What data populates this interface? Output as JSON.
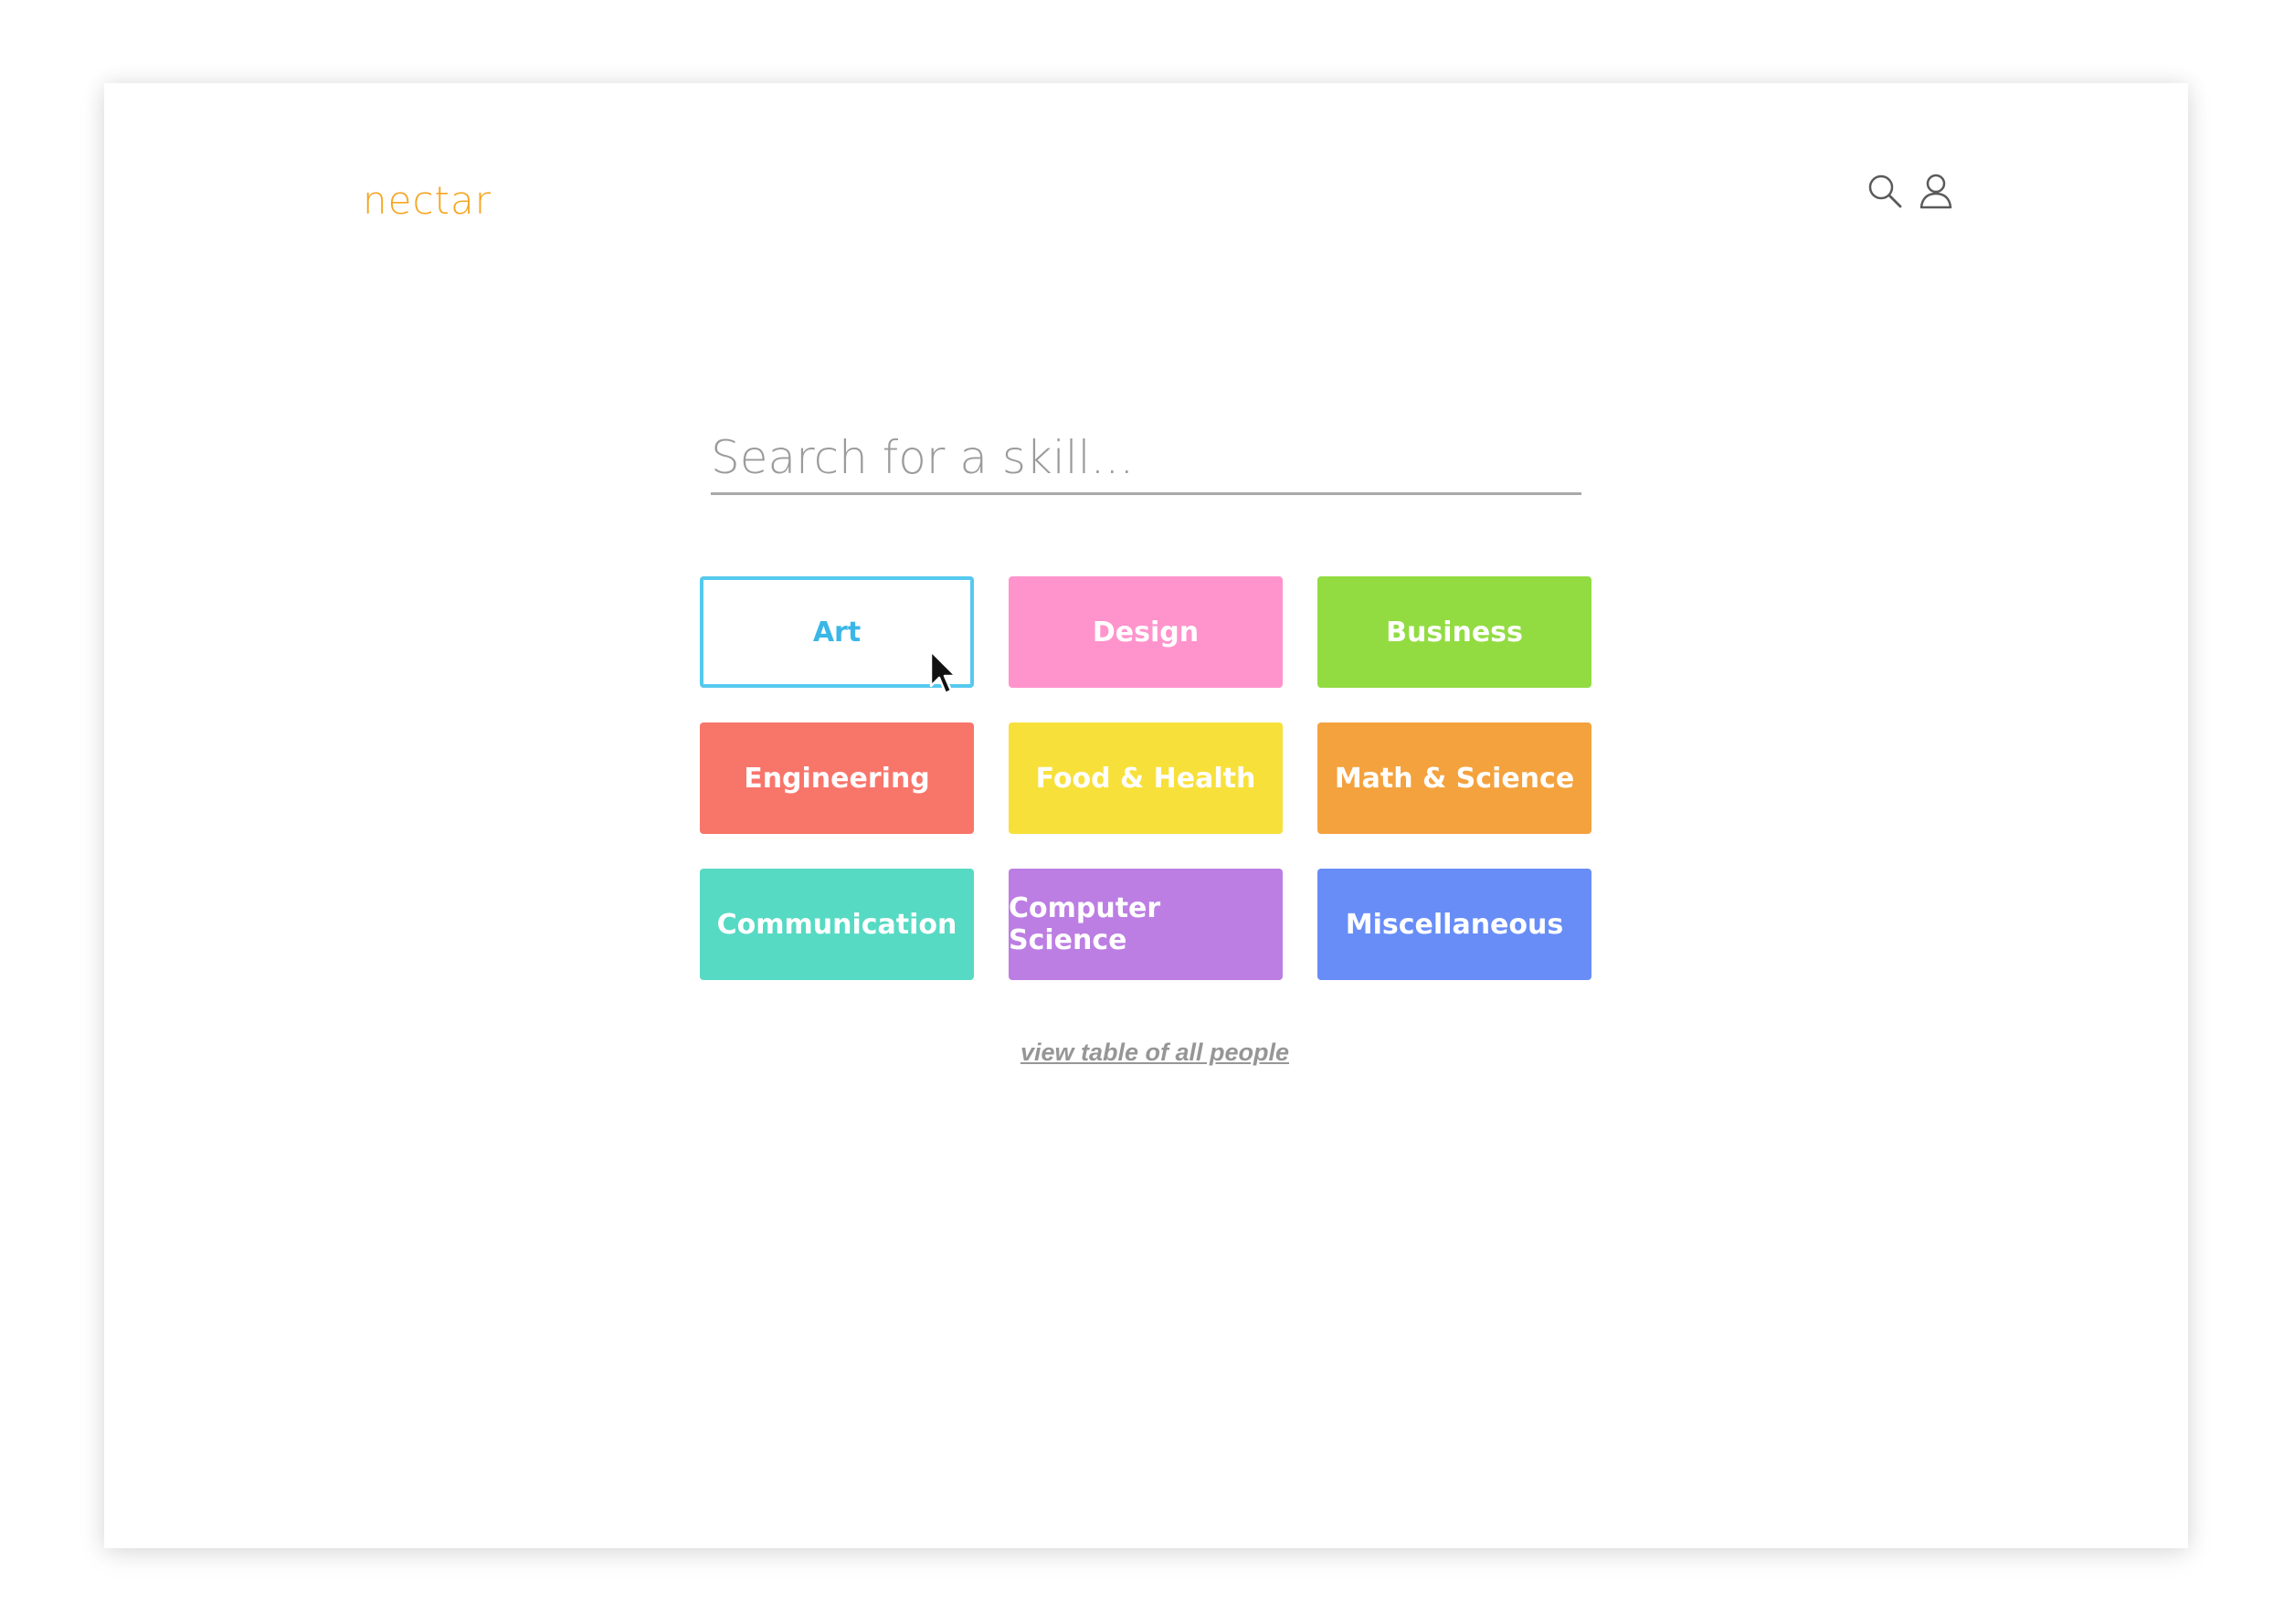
{
  "app": {
    "logo": "nectar",
    "accent_color": "#f5a623"
  },
  "header": {
    "icons": [
      "search-icon",
      "user-icon"
    ]
  },
  "search": {
    "placeholder": "Search for a skill...",
    "value": ""
  },
  "categories": [
    {
      "label": "Art",
      "color": "#ffffff",
      "state": "hover"
    },
    {
      "label": "Design",
      "color": "#ff94cc"
    },
    {
      "label": "Business",
      "color": "#92dc42"
    },
    {
      "label": "Engineering",
      "color": "#f8756a"
    },
    {
      "label": "Food & Health",
      "color": "#f8e03a"
    },
    {
      "label": "Math & Science",
      "color": "#f4a23e"
    },
    {
      "label": "Communication",
      "color": "#56dac3"
    },
    {
      "label": "Computer Science",
      "color": "#bc7ee3"
    },
    {
      "label": "Miscellaneous",
      "color": "#688df7"
    }
  ],
  "footer_link": {
    "label": "view table of all people"
  }
}
